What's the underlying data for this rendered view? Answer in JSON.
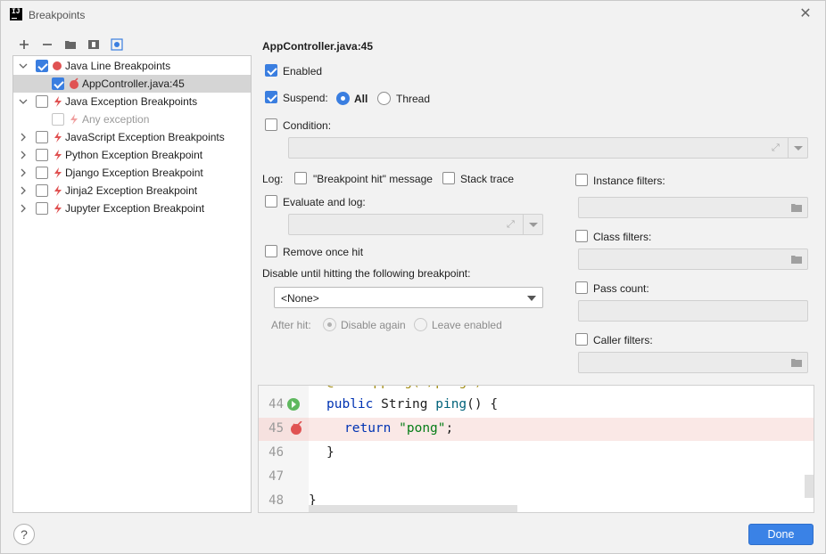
{
  "window": {
    "title": "Breakpoints"
  },
  "tree": {
    "items": [
      {
        "label": "Java Line Breakpoints",
        "checked": true,
        "expanded": true
      },
      {
        "label": "AppController.java:45",
        "checked": true,
        "selected": true
      },
      {
        "label": "Java Exception Breakpoints",
        "checked": false,
        "expanded": true
      },
      {
        "label": "Any exception",
        "checked": false,
        "disabled": true
      },
      {
        "label": "JavaScript Exception Breakpoints",
        "checked": false
      },
      {
        "label": "Python Exception Breakpoint",
        "checked": false
      },
      {
        "label": "Django Exception Breakpoint",
        "checked": false
      },
      {
        "label": "Jinja2 Exception Breakpoint",
        "checked": false
      },
      {
        "label": "Jupyter Exception Breakpoint",
        "checked": false
      }
    ]
  },
  "details": {
    "title": "AppController.java:45",
    "enabled": "Enabled",
    "suspend": "Suspend:",
    "suspend_all": "All",
    "suspend_thread": "Thread",
    "condition": "Condition:",
    "log": "Log:",
    "log_message": "\"Breakpoint hit\" message",
    "stack_trace": "Stack trace",
    "evaluate_log": "Evaluate and log:",
    "remove_once_hit": "Remove once hit",
    "disable_until": "Disable until hitting the following breakpoint:",
    "disable_until_value": "<None>",
    "after_hit": "After hit:",
    "disable_again": "Disable again",
    "leave_enabled": "Leave enabled",
    "instance_filters": "Instance filters:",
    "class_filters": "Class filters:",
    "pass_count": "Pass count:",
    "caller_filters": "Caller filters:"
  },
  "editor": {
    "lines": [
      {
        "n": "44",
        "code_kw": "public",
        "code_rest": " String ",
        "code_fn": "ping",
        "code_tail": "() {"
      },
      {
        "n": "45",
        "code_kw": "return",
        "code_str": "\"pong\"",
        "code_tail": ";"
      },
      {
        "n": "46",
        "code": "}"
      },
      {
        "n": "47",
        "code": ""
      },
      {
        "n": "48",
        "code": "}"
      }
    ]
  },
  "footer": {
    "help": "?",
    "done": "Done"
  }
}
